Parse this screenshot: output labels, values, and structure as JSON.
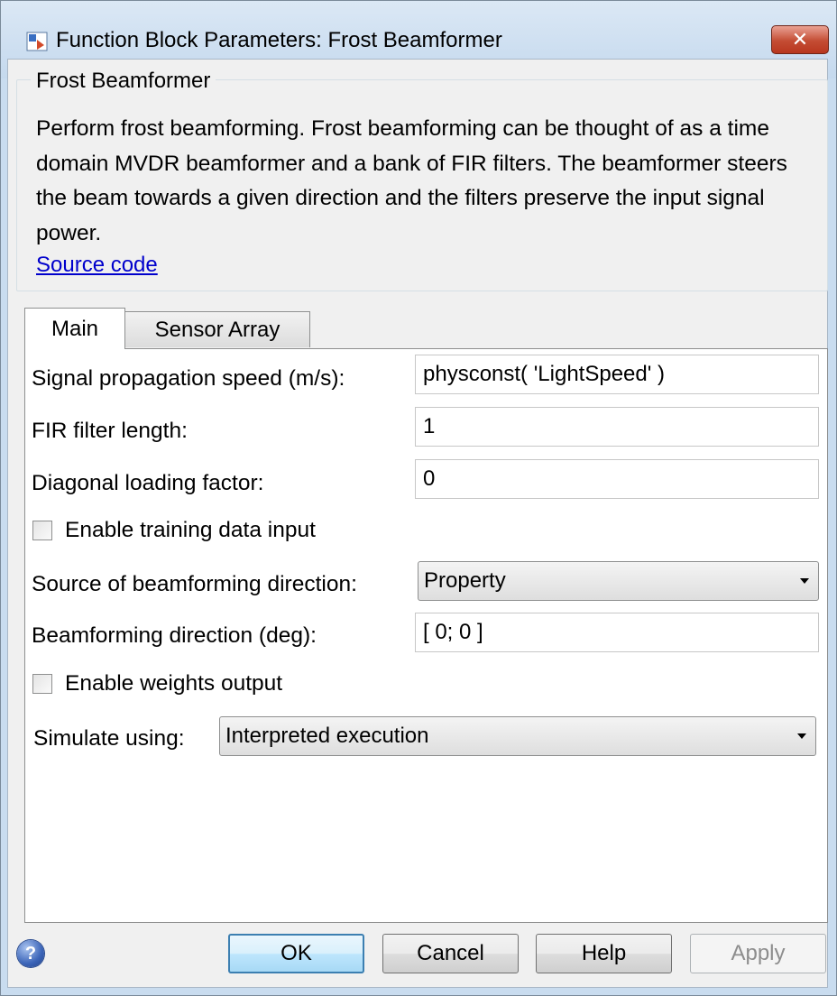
{
  "window": {
    "title": "Function Block Parameters: Frost Beamformer",
    "close_glyph": "✕"
  },
  "description_group": {
    "legend": "Frost Beamformer",
    "text": "Perform frost beamforming. Frost beamforming can be thought of as a time domain MVDR beamformer and a bank of FIR filters. The beamformer steers the beam towards a given direction and the filters preserve the input signal power.",
    "link": "Source code"
  },
  "tabs": [
    {
      "label": "Main",
      "selected": true
    },
    {
      "label": "Sensor Array",
      "selected": false
    }
  ],
  "main": {
    "propagation_speed": {
      "label": "Signal propagation speed (m/s):",
      "value": "physconst( 'LightSpeed' )"
    },
    "fir_length": {
      "label": "FIR filter length:",
      "value": "1"
    },
    "diagonal_loading": {
      "label": "Diagonal loading factor:",
      "value": "0"
    },
    "training_input": {
      "label": "Enable training data input",
      "checked": false
    },
    "direction_source": {
      "label": "Source of beamforming direction:",
      "value": "Property"
    },
    "direction": {
      "label": "Beamforming direction (deg):",
      "value": "[ 0; 0 ]"
    },
    "weights_output": {
      "label": "Enable weights output",
      "checked": false
    },
    "simulate": {
      "label": "Simulate using:",
      "value": "Interpreted execution"
    }
  },
  "buttons": {
    "ok": "OK",
    "cancel": "Cancel",
    "help": "Help",
    "apply": "Apply"
  },
  "icons": {
    "app": "block-parameters-icon",
    "help": "question-icon",
    "help_glyph": "?"
  },
  "colors": {
    "titlebar": "#c9dcef",
    "close_button": "#c44c33",
    "link": "#0000cc",
    "default_button_border": "#3c7fb1",
    "disabled_text": "#8d8d8d"
  }
}
